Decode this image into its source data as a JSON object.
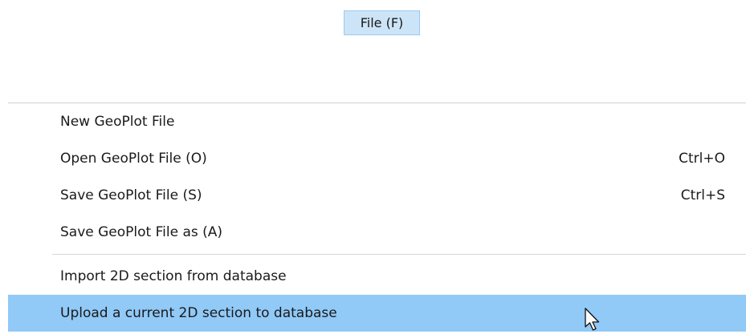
{
  "menubar": {
    "file_label": "File (F)"
  },
  "menu": {
    "items": [
      {
        "label": "New GeoPlot File",
        "shortcut": ""
      },
      {
        "label": "Open GeoPlot File (O)",
        "shortcut": "Ctrl+O"
      },
      {
        "label": "Save GeoPlot File (S)",
        "shortcut": "Ctrl+S"
      },
      {
        "label": "Save GeoPlot File as (A)",
        "shortcut": ""
      },
      {
        "label": "Import 2D section from database",
        "shortcut": ""
      },
      {
        "label": "Upload a current 2D section to database",
        "shortcut": ""
      }
    ],
    "highlighted_index": 5
  },
  "colors": {
    "menubar_selected_bg": "#cce4f7",
    "menu_highlight_bg": "#91c9f7"
  },
  "cursor": {
    "icon": "mouse-pointer-icon"
  }
}
